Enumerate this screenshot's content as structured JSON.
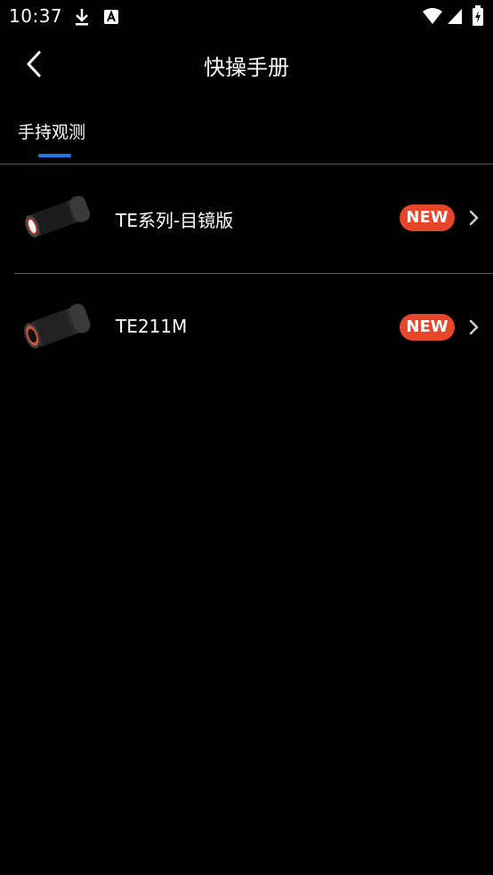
{
  "status_bar": {
    "time": "10:37",
    "icons": [
      "download-icon",
      "a-icon",
      "wifi-icon",
      "signal-icon",
      "battery-icon"
    ]
  },
  "app_bar": {
    "title": "快操手册",
    "back_icon": "chevron-left-icon"
  },
  "tabs": [
    {
      "label": "手持观测",
      "active": true
    }
  ],
  "colors": {
    "background": "#000000",
    "tab_indicator": "#1e7ae8",
    "badge": "#e8462a",
    "divider": "#5a5a5a"
  },
  "items": [
    {
      "label": "TE系列-目镜版",
      "badge": "NEW",
      "thumbnail": "thermal-monocular-image"
    },
    {
      "label": "TE211M",
      "badge": "NEW",
      "thumbnail": "thermal-monocular-image"
    }
  ]
}
